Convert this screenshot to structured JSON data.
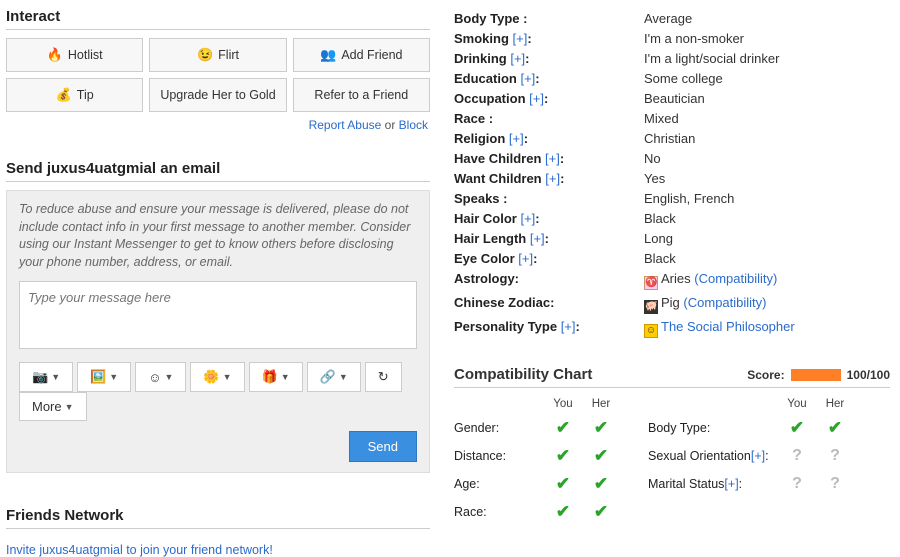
{
  "interact": {
    "heading": "Interact",
    "buttons": {
      "hotlist": "Hotlist",
      "flirt": "Flirt",
      "add_friend": "Add Friend",
      "tip": "Tip",
      "upgrade": "Upgrade Her to Gold",
      "refer": "Refer to a Friend"
    },
    "report_abuse": "Report Abuse",
    "or": " or ",
    "block": "Block"
  },
  "email": {
    "heading": "Send juxus4uatgmial an email",
    "warning": "To reduce abuse and ensure your message is delivered, please do not include contact info in your first message to another member. Consider using our Instant Messenger to get to know others before disclosing your phone number, address, or email.",
    "placeholder": "Type your message here",
    "more": "More",
    "send": "Send"
  },
  "friends": {
    "heading": "Friends Network",
    "invite": "Invite juxus4uatgmial to join your friend network!"
  },
  "profile": {
    "body_type": {
      "label": "Body Type :",
      "value": "Average"
    },
    "smoking": {
      "label": "Smoking ",
      "value": "I'm a non-smoker"
    },
    "drinking": {
      "label": "Drinking ",
      "value": "I'm a light/social drinker"
    },
    "education": {
      "label": "Education ",
      "value": "Some college"
    },
    "occupation": {
      "label": "Occupation ",
      "value": "Beautician"
    },
    "race": {
      "label": "Race :",
      "value": "Mixed"
    },
    "religion": {
      "label": "Religion ",
      "value": "Christian"
    },
    "have_children": {
      "label": "Have Children ",
      "value": "No"
    },
    "want_children": {
      "label": "Want Children ",
      "value": "Yes"
    },
    "speaks": {
      "label": "Speaks :",
      "value": "English, French"
    },
    "hair_color": {
      "label": "Hair Color ",
      "value": "Black"
    },
    "hair_length": {
      "label": "Hair Length ",
      "value": "Long"
    },
    "eye_color": {
      "label": "Eye Color ",
      "value": "Black"
    },
    "astrology": {
      "label": "Astrology:",
      "value": "Aries",
      "link": "(Compatibility)"
    },
    "zodiac": {
      "label": "Chinese Zodiac:",
      "value": "Pig",
      "link": "(Compatibility)"
    },
    "personality": {
      "label": "Personality Type ",
      "value": "The Social Philosopher"
    },
    "plus": "[+]",
    "colon": ":"
  },
  "compat": {
    "heading": "Compatibility Chart",
    "score_label": "Score:",
    "score_text": "100/100",
    "col_you": "You",
    "col_her": "Her",
    "rows_left": {
      "gender": "Gender:",
      "distance": "Distance:",
      "age": "Age:",
      "race": "Race:"
    },
    "rows_right": {
      "body_type": "Body Type:",
      "sexual": "Sexual Orientation",
      "marital": "Marital Status"
    },
    "plus": "[+]",
    "colon": ":"
  }
}
